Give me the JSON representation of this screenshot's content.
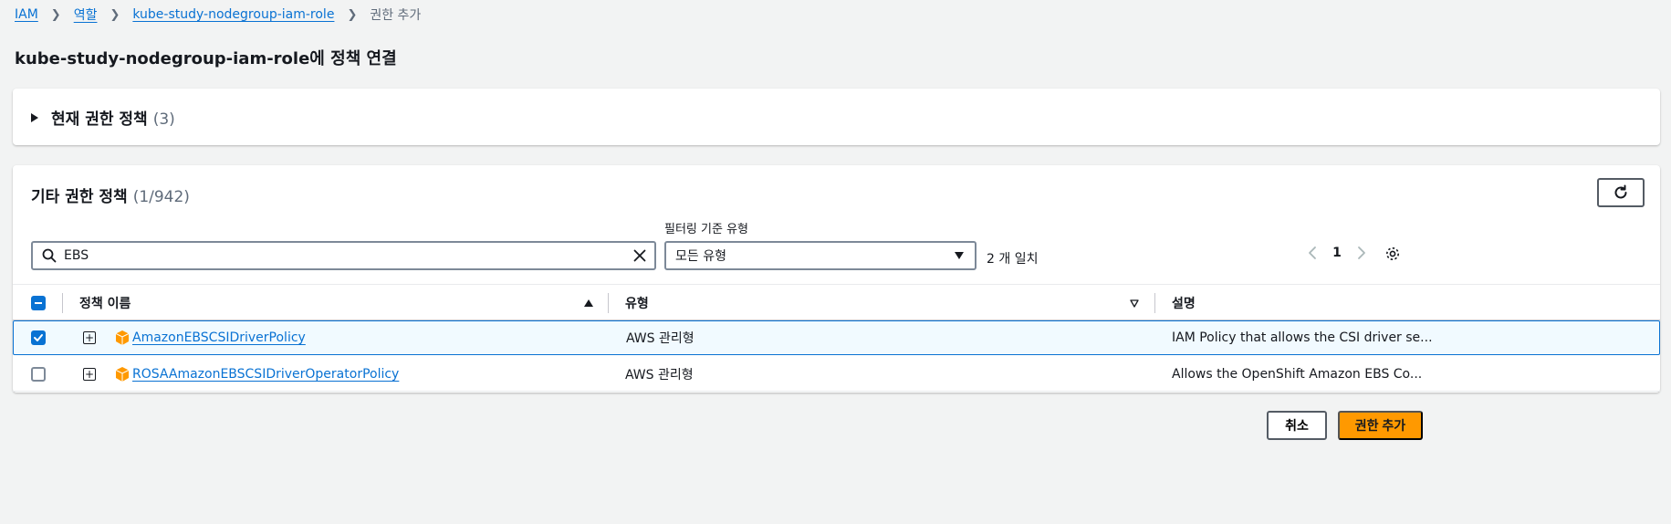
{
  "breadcrumb": {
    "items": [
      "IAM",
      "역할",
      "kube-study-nodegroup-iam-role"
    ],
    "current": "권한 추가"
  },
  "page": {
    "title": "kube-study-nodegroup-iam-role에 정책 연결"
  },
  "current_policies": {
    "title": "현재 권한 정책",
    "count": "(3)"
  },
  "other_policies": {
    "title": "기타 권한 정책",
    "count": "(1/942)",
    "search_value": "EBS",
    "filter_label": "필터링 기준 유형",
    "filter_value": "모든 유형",
    "match_text": "2 개 일치",
    "page_number": "1"
  },
  "table": {
    "columns": {
      "name": "정책 이름",
      "type": "유형",
      "description": "설명"
    },
    "rows": [
      {
        "name": "AmazonEBSCSIDriverPolicy",
        "type": "AWS 관리형",
        "description": "IAM Policy that allows the CSI driver se...",
        "checked": true
      },
      {
        "name": "ROSAAmazonEBSCSIDriverOperatorPolicy",
        "type": "AWS 관리형",
        "description": "Allows the OpenShift Amazon EBS Co...",
        "checked": false
      }
    ]
  },
  "actions": {
    "cancel": "취소",
    "add": "권한 추가"
  },
  "colors": {
    "link": "#0972d3",
    "primary_button": "#ff9900",
    "aws_cube": "#ff9900"
  },
  "icons": {
    "search": "search-icon",
    "clear": "close-icon",
    "refresh": "refresh-icon",
    "settings": "gear-icon",
    "prev": "chevron-left-icon",
    "next": "chevron-right-icon",
    "managed_policy": "aws-cube-icon",
    "expand": "plus-box-icon"
  }
}
